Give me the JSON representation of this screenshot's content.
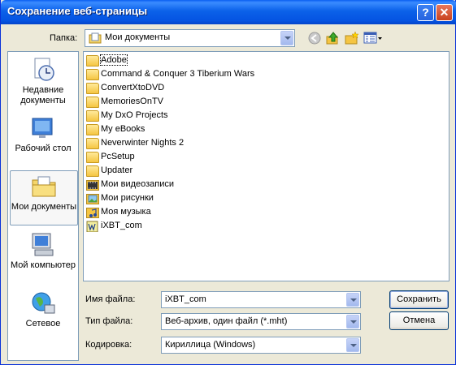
{
  "window": {
    "title": "Сохранение веб-страницы",
    "help_glyph": "?",
    "close_glyph": "✕"
  },
  "folder_bar": {
    "label": "Папка:",
    "current": "Мои документы"
  },
  "places": [
    {
      "label": "Недавние документы",
      "icon": "recent-documents-icon"
    },
    {
      "label": "Рабочий стол",
      "icon": "desktop-icon"
    },
    {
      "label": "Мои документы",
      "icon": "my-documents-icon"
    },
    {
      "label": "Мой компьютер",
      "icon": "my-computer-icon"
    },
    {
      "label": "Сетевое",
      "icon": "network-icon"
    }
  ],
  "files": [
    {
      "name": "Adobe",
      "icon": "folder-icon"
    },
    {
      "name": "Command & Conquer 3 Tiberium Wars",
      "icon": "folder-icon"
    },
    {
      "name": "ConvertXtoDVD",
      "icon": "folder-icon"
    },
    {
      "name": "MemoriesOnTV",
      "icon": "folder-icon"
    },
    {
      "name": "My DxO Projects",
      "icon": "folder-icon"
    },
    {
      "name": "My eBooks",
      "icon": "folder-icon"
    },
    {
      "name": "Neverwinter Nights 2",
      "icon": "folder-icon"
    },
    {
      "name": "PcSetup",
      "icon": "folder-icon"
    },
    {
      "name": "Updater",
      "icon": "folder-icon"
    },
    {
      "name": "Мои видеозаписи",
      "icon": "video-folder-icon"
    },
    {
      "name": "Мои рисунки",
      "icon": "pictures-folder-icon"
    },
    {
      "name": "Моя музыка",
      "icon": "music-folder-icon"
    },
    {
      "name": "iXBT_com",
      "icon": "web-archive-icon"
    }
  ],
  "form": {
    "filename_label": "Имя файла:",
    "filename_value": "iXBT_com",
    "filetype_label": "Тип файла:",
    "filetype_value": "Веб-архив, один файл  (*.mht)",
    "encoding_label": "Кодировка:",
    "encoding_value": "Кириллица (Windows)"
  },
  "buttons": {
    "save": "Сохранить",
    "cancel": "Отмена"
  }
}
